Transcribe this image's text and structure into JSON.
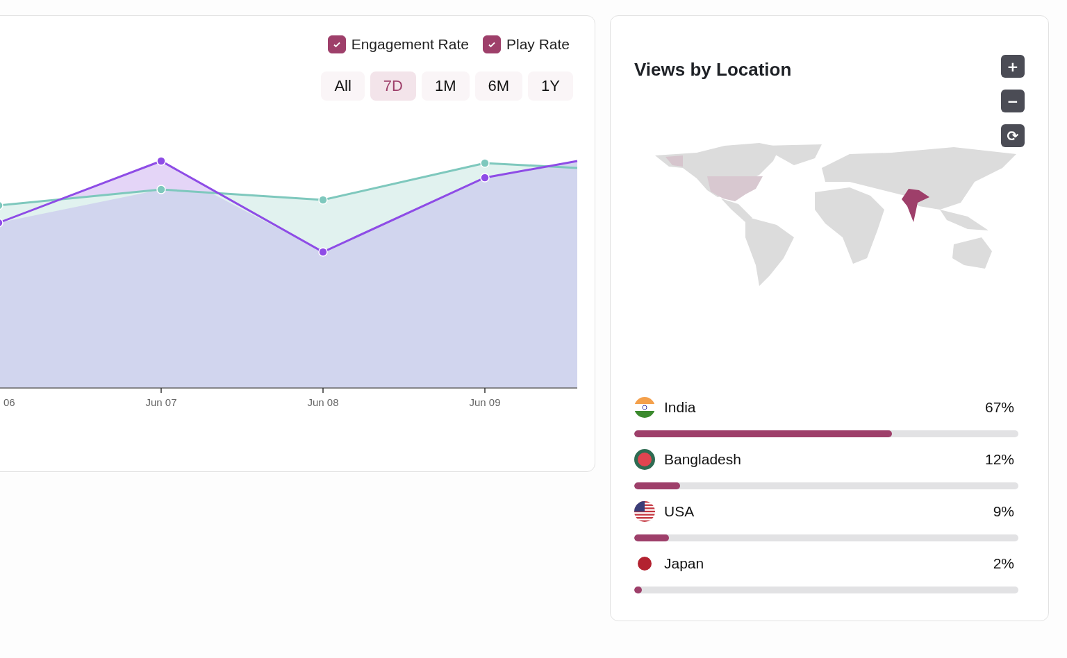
{
  "trend_card": {
    "legend": [
      {
        "label": "Engagement Rate",
        "checked": true
      },
      {
        "label": "Play Rate",
        "checked": true
      }
    ],
    "ranges": [
      {
        "label": "All",
        "selected": false
      },
      {
        "label": "7D",
        "selected": true
      },
      {
        "label": "1M",
        "selected": false
      },
      {
        "label": "6M",
        "selected": false
      },
      {
        "label": "1Y",
        "selected": false
      }
    ],
    "x_labels": [
      "06",
      "Jun 07",
      "Jun 08",
      "Jun 09"
    ]
  },
  "location_card": {
    "title": "Views by Location",
    "map_controls": [
      "+",
      "−",
      "⟳"
    ],
    "countries": [
      {
        "name": "India",
        "percent": "67%",
        "level": 0.67
      },
      {
        "name": "Bangladesh",
        "percent": "12%",
        "level": 0.12
      },
      {
        "name": "USA",
        "percent": "9%",
        "level": 0.09
      },
      {
        "name": "Japan",
        "percent": "2%",
        "level": 0.02
      }
    ]
  }
}
